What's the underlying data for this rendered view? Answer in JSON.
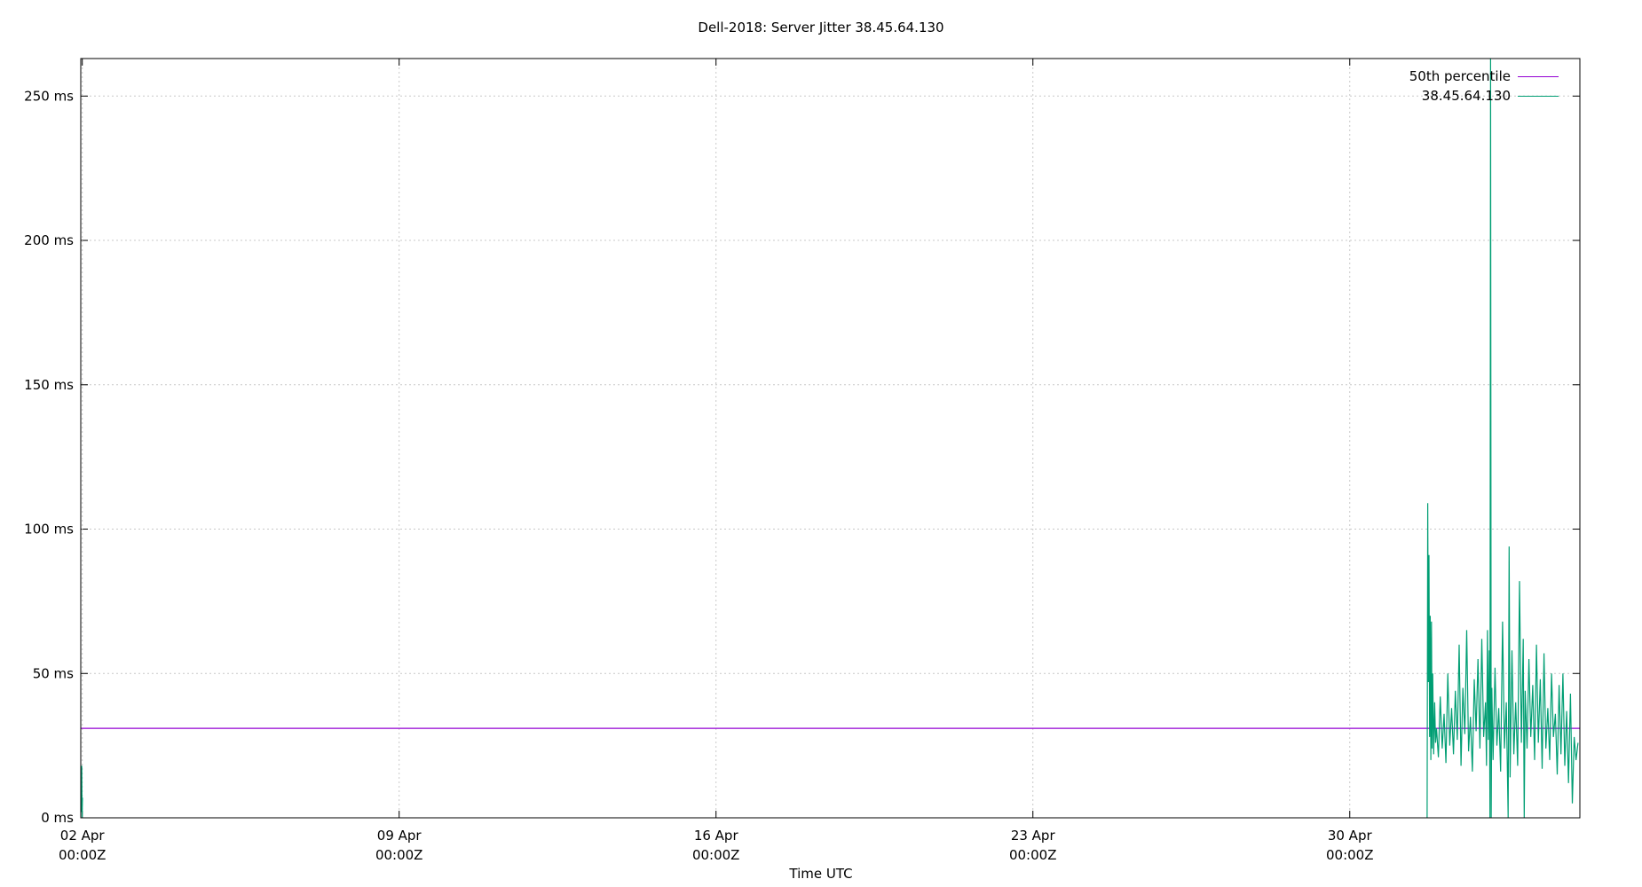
{
  "chart_data": {
    "type": "line",
    "title": "Dell-2018: Server Jitter 38.45.64.130",
    "xlabel": "Time UTC",
    "ylabel": "",
    "ylim": [
      0,
      263
    ],
    "xlim": [
      "2018-04-01T23:12Z",
      "2018-05-05T02:00Z"
    ],
    "y_ticks": [
      {
        "value": 0,
        "label": "0 ms"
      },
      {
        "value": 50,
        "label": "50 ms"
      },
      {
        "value": 100,
        "label": "100 ms"
      },
      {
        "value": 150,
        "label": "150 ms"
      },
      {
        "value": 200,
        "label": "200 ms"
      },
      {
        "value": 250,
        "label": "250 ms"
      }
    ],
    "x_ticks": [
      {
        "value": "2018-04-02T00:00Z",
        "line1": "02 Apr",
        "line2": "00:00Z"
      },
      {
        "value": "2018-04-09T00:00Z",
        "line1": "09 Apr",
        "line2": "00:00Z"
      },
      {
        "value": "2018-04-16T00:00Z",
        "line1": "16 Apr",
        "line2": "00:00Z"
      },
      {
        "value": "2018-04-23T00:00Z",
        "line1": "23 Apr",
        "line2": "00:00Z"
      },
      {
        "value": "2018-04-30T00:00Z",
        "line1": "30 Apr",
        "line2": "00:00Z"
      }
    ],
    "grid": true,
    "legend_position": "top-right",
    "series": [
      {
        "name": "50th percentile",
        "color": "#9400d3",
        "points": [
          [
            "2018-04-01T23:12Z",
            31
          ],
          [
            "2018-05-05T02:00Z",
            31
          ]
        ]
      },
      {
        "name": "38.45.64.130",
        "color": "#009e73",
        "points": [
          [
            "2018-04-01T23:30Z",
            2
          ],
          [
            "2018-04-01T23:42Z",
            18
          ],
          [
            "2018-04-01T23:54Z",
            0
          ],
          [
            "2018-04-02T00:06Z",
            7
          ],
          [
            "2018-05-01T17:00Z",
            0
          ],
          [
            "2018-05-01T17:20Z",
            109
          ],
          [
            "2018-05-01T17:40Z",
            47
          ],
          [
            "2018-05-01T18:00Z",
            91
          ],
          [
            "2018-05-01T18:20Z",
            28
          ],
          [
            "2018-05-01T18:40Z",
            70
          ],
          [
            "2018-05-01T19:00Z",
            20
          ],
          [
            "2018-05-01T19:20Z",
            68
          ],
          [
            "2018-05-01T19:40Z",
            24
          ],
          [
            "2018-05-01T20:00Z",
            50
          ],
          [
            "2018-05-01T20:30Z",
            22
          ],
          [
            "2018-05-01T21:00Z",
            40
          ],
          [
            "2018-05-01T21:30Z",
            26
          ],
          [
            "2018-05-01T22:00Z",
            31
          ],
          [
            "2018-05-01T23:00Z",
            21
          ],
          [
            "2018-05-02T00:00Z",
            42
          ],
          [
            "2018-05-02T01:00Z",
            24
          ],
          [
            "2018-05-02T02:00Z",
            36
          ],
          [
            "2018-05-02T03:00Z",
            19
          ],
          [
            "2018-05-02T04:00Z",
            50
          ],
          [
            "2018-05-02T05:00Z",
            25
          ],
          [
            "2018-05-02T06:00Z",
            38
          ],
          [
            "2018-05-02T07:00Z",
            22
          ],
          [
            "2018-05-02T08:00Z",
            44
          ],
          [
            "2018-05-02T09:00Z",
            27
          ],
          [
            "2018-05-02T10:00Z",
            60
          ],
          [
            "2018-05-02T11:00Z",
            18
          ],
          [
            "2018-05-02T12:00Z",
            45
          ],
          [
            "2018-05-02T13:00Z",
            29
          ],
          [
            "2018-05-02T14:00Z",
            65
          ],
          [
            "2018-05-02T15:00Z",
            23
          ],
          [
            "2018-05-02T16:00Z",
            35
          ],
          [
            "2018-05-02T17:00Z",
            16
          ],
          [
            "2018-05-02T18:00Z",
            48
          ],
          [
            "2018-05-02T19:00Z",
            30
          ],
          [
            "2018-05-02T20:00Z",
            55
          ],
          [
            "2018-05-02T21:00Z",
            24
          ],
          [
            "2018-05-02T22:00Z",
            62
          ],
          [
            "2018-05-02T23:00Z",
            28
          ],
          [
            "2018-05-03T00:00Z",
            40
          ],
          [
            "2018-05-03T00:30Z",
            18
          ],
          [
            "2018-05-03T01:00Z",
            65
          ],
          [
            "2018-05-03T01:30Z",
            27
          ],
          [
            "2018-05-03T02:00Z",
            58
          ],
          [
            "2018-05-03T02:20Z",
            0
          ],
          [
            "2018-05-03T02:40Z",
            263
          ],
          [
            "2018-05-03T03:00Z",
            0
          ],
          [
            "2018-05-03T03:20Z",
            45
          ],
          [
            "2018-05-03T04:00Z",
            20
          ],
          [
            "2018-05-03T05:00Z",
            52
          ],
          [
            "2018-05-03T06:00Z",
            25
          ],
          [
            "2018-05-03T07:00Z",
            38
          ],
          [
            "2018-05-03T08:00Z",
            16
          ],
          [
            "2018-05-03T09:00Z",
            68
          ],
          [
            "2018-05-03T10:00Z",
            24
          ],
          [
            "2018-05-03T11:00Z",
            40
          ],
          [
            "2018-05-03T12:00Z",
            0
          ],
          [
            "2018-05-03T12:30Z",
            94
          ],
          [
            "2018-05-03T13:00Z",
            14
          ],
          [
            "2018-05-03T14:00Z",
            58
          ],
          [
            "2018-05-03T15:00Z",
            22
          ],
          [
            "2018-05-03T16:00Z",
            40
          ],
          [
            "2018-05-03T17:00Z",
            18
          ],
          [
            "2018-05-03T18:00Z",
            82
          ],
          [
            "2018-05-03T19:00Z",
            26
          ],
          [
            "2018-05-03T20:00Z",
            62
          ],
          [
            "2018-05-03T20:30Z",
            0
          ],
          [
            "2018-05-03T21:00Z",
            44
          ],
          [
            "2018-05-03T22:00Z",
            24
          ],
          [
            "2018-05-03T23:00Z",
            55
          ],
          [
            "2018-05-04T00:00Z",
            28
          ],
          [
            "2018-05-04T01:00Z",
            46
          ],
          [
            "2018-05-04T02:00Z",
            20
          ],
          [
            "2018-05-04T03:00Z",
            60
          ],
          [
            "2018-05-04T04:00Z",
            26
          ],
          [
            "2018-05-04T05:00Z",
            48
          ],
          [
            "2018-05-04T06:00Z",
            17
          ],
          [
            "2018-05-04T07:00Z",
            57
          ],
          [
            "2018-05-04T08:00Z",
            24
          ],
          [
            "2018-05-04T09:00Z",
            38
          ],
          [
            "2018-05-04T10:00Z",
            20
          ],
          [
            "2018-05-04T11:00Z",
            50
          ],
          [
            "2018-05-04T12:00Z",
            28
          ],
          [
            "2018-05-04T13:00Z",
            36
          ],
          [
            "2018-05-04T14:00Z",
            15
          ],
          [
            "2018-05-04T15:00Z",
            46
          ],
          [
            "2018-05-04T16:00Z",
            22
          ],
          [
            "2018-05-04T17:00Z",
            50
          ],
          [
            "2018-05-04T18:00Z",
            18
          ],
          [
            "2018-05-04T19:00Z",
            37
          ],
          [
            "2018-05-04T20:00Z",
            12
          ],
          [
            "2018-05-04T21:00Z",
            43
          ],
          [
            "2018-05-04T22:00Z",
            5
          ],
          [
            "2018-05-04T23:00Z",
            28
          ],
          [
            "2018-05-05T00:00Z",
            20
          ],
          [
            "2018-05-05T01:00Z",
            26
          ]
        ]
      }
    ]
  }
}
